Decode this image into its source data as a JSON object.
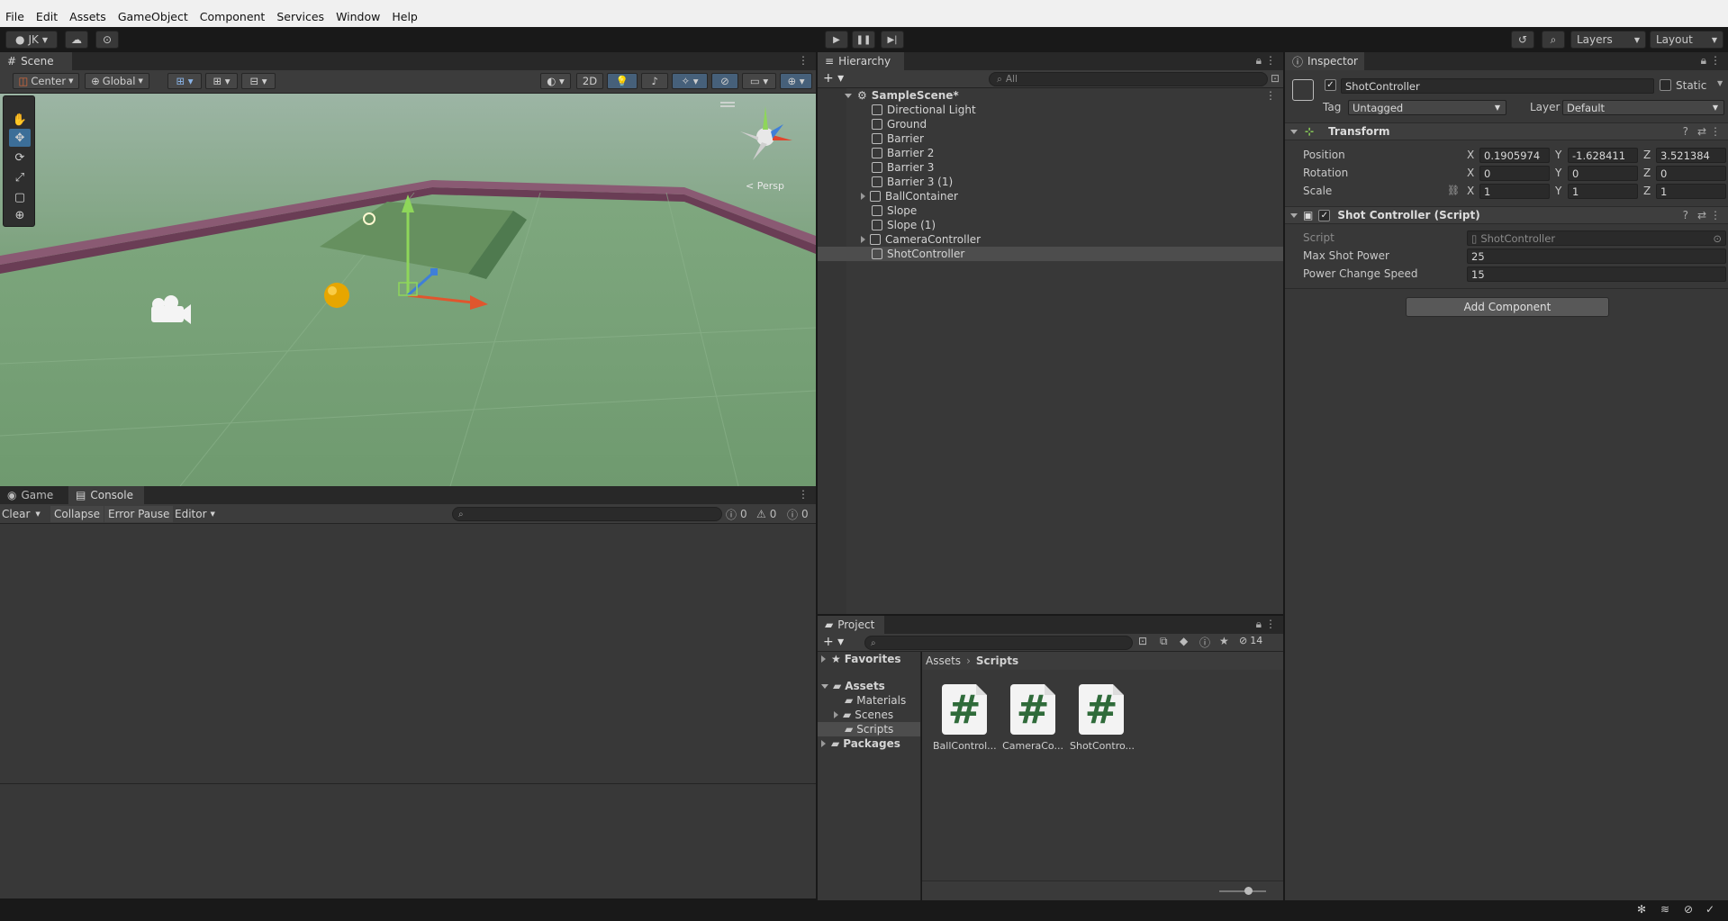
{
  "menu": [
    "File",
    "Edit",
    "Assets",
    "GameObject",
    "Component",
    "Services",
    "Window",
    "Help"
  ],
  "toolbar": {
    "account": "JK",
    "layers": "Layers",
    "layout": "Layout"
  },
  "scene": {
    "tab": "Scene",
    "pivot": "Center",
    "space": "Global",
    "mode2d": "2D",
    "persp": "< Persp"
  },
  "console": {
    "tabs": [
      "Game",
      "Console"
    ],
    "clear": "Clear",
    "collapse": "Collapse",
    "error_pause": "Error Pause",
    "editor": "Editor",
    "count_messages": "0",
    "count_warnings": "0",
    "count_errors": "0"
  },
  "hierarchy": {
    "tab": "Hierarchy",
    "search_placeholder": "All",
    "scene_name": "SampleScene*",
    "items": [
      {
        "label": "Directional Light",
        "expandable": false
      },
      {
        "label": "Ground",
        "expandable": false
      },
      {
        "label": "Barrier",
        "expandable": false
      },
      {
        "label": "Barrier 2",
        "expandable": false
      },
      {
        "label": "Barrier 3",
        "expandable": false
      },
      {
        "label": "Barrier 3 (1)",
        "expandable": false
      },
      {
        "label": "BallContainer",
        "expandable": true
      },
      {
        "label": "Slope",
        "expandable": false
      },
      {
        "label": "Slope (1)",
        "expandable": false
      },
      {
        "label": "CameraController",
        "expandable": true
      },
      {
        "label": "ShotController",
        "expandable": false,
        "selected": true
      }
    ]
  },
  "project": {
    "tab": "Project",
    "hidden_count": "14",
    "favorites": "Favorites",
    "assets": "Assets",
    "folders": [
      "Materials",
      "Scenes",
      "Scripts"
    ],
    "packages": "Packages",
    "breadcrumb": [
      "Assets",
      "Scripts"
    ],
    "files": [
      "BallControl...",
      "CameraCo...",
      "ShotContro..."
    ]
  },
  "inspector": {
    "tab": "Inspector",
    "object_name": "ShotController",
    "static_label": "Static",
    "tag_label": "Tag",
    "tag_value": "Untagged",
    "layer_label": "Layer",
    "layer_value": "Default",
    "transform": {
      "title": "Transform",
      "position_label": "Position",
      "rotation_label": "Rotation",
      "scale_label": "Scale",
      "position": {
        "x": "0.1905974",
        "y": "-1.628411",
        "z": "3.521384"
      },
      "rotation": {
        "x": "0",
        "y": "0",
        "z": "0"
      },
      "scale": {
        "x": "1",
        "y": "1",
        "z": "1"
      },
      "axis_x": "X",
      "axis_y": "Y",
      "axis_z": "Z"
    },
    "script_component": {
      "title": "Shot Controller (Script)",
      "script_label": "Script",
      "script_value": "ShotController",
      "max_power_label": "Max Shot Power",
      "max_power_value": "25",
      "power_speed_label": "Power Change Speed",
      "power_speed_value": "15"
    },
    "add_component": "Add Component"
  },
  "colors": {
    "accent_selected": "#2c5d87",
    "panel_bg": "#383838",
    "ground_green": "#6f9a6f"
  }
}
